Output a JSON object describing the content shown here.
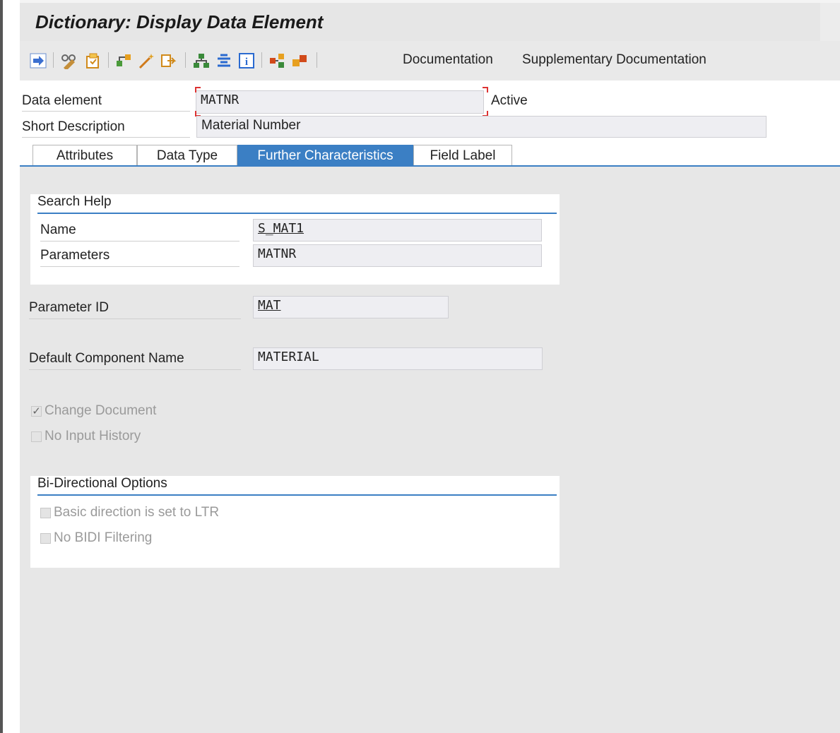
{
  "window": {
    "title": "Dictionary: Display Data Element"
  },
  "toolbar": {
    "icons": [
      "arrow-right-icon",
      "glasses-icon",
      "copy-icon",
      "hierarchy-icon",
      "magic-wand-icon",
      "export-icon",
      "tree-icon",
      "list-icon",
      "info-icon",
      "graph-icon",
      "compare-icon"
    ],
    "documentation_label": "Documentation",
    "supplementary_label": "Supplementary Documentation"
  },
  "header": {
    "data_element_label": "Data element",
    "data_element_value": "MATNR",
    "status": "Active",
    "short_description_label": "Short Description",
    "short_description_value": "Material Number"
  },
  "tabs": [
    {
      "label": "Attributes",
      "active": false
    },
    {
      "label": "Data Type",
      "active": false
    },
    {
      "label": "Further Characteristics",
      "active": true
    },
    {
      "label": "Field Label",
      "active": false
    }
  ],
  "search_help": {
    "title": "Search Help",
    "name_label": "Name",
    "name_value": "S_MAT1",
    "parameters_label": "Parameters",
    "parameters_value": "MATNR"
  },
  "parameter_id": {
    "label": "Parameter ID",
    "value": "MAT"
  },
  "default_component": {
    "label": "Default Component Name",
    "value": "MATERIAL"
  },
  "options": {
    "change_document": {
      "label": "Change Document",
      "checked": true
    },
    "no_input_history": {
      "label": "No Input History",
      "checked": false
    }
  },
  "bidi": {
    "title": "Bi-Directional Options",
    "basic_direction": {
      "label": "Basic direction is set to LTR",
      "checked": false
    },
    "no_bidi_filtering": {
      "label": "No BIDI Filtering",
      "checked": false
    }
  },
  "colors": {
    "accent": "#3b7fc4",
    "background": "#e7e7e7",
    "field_bg": "#eeeef2"
  }
}
